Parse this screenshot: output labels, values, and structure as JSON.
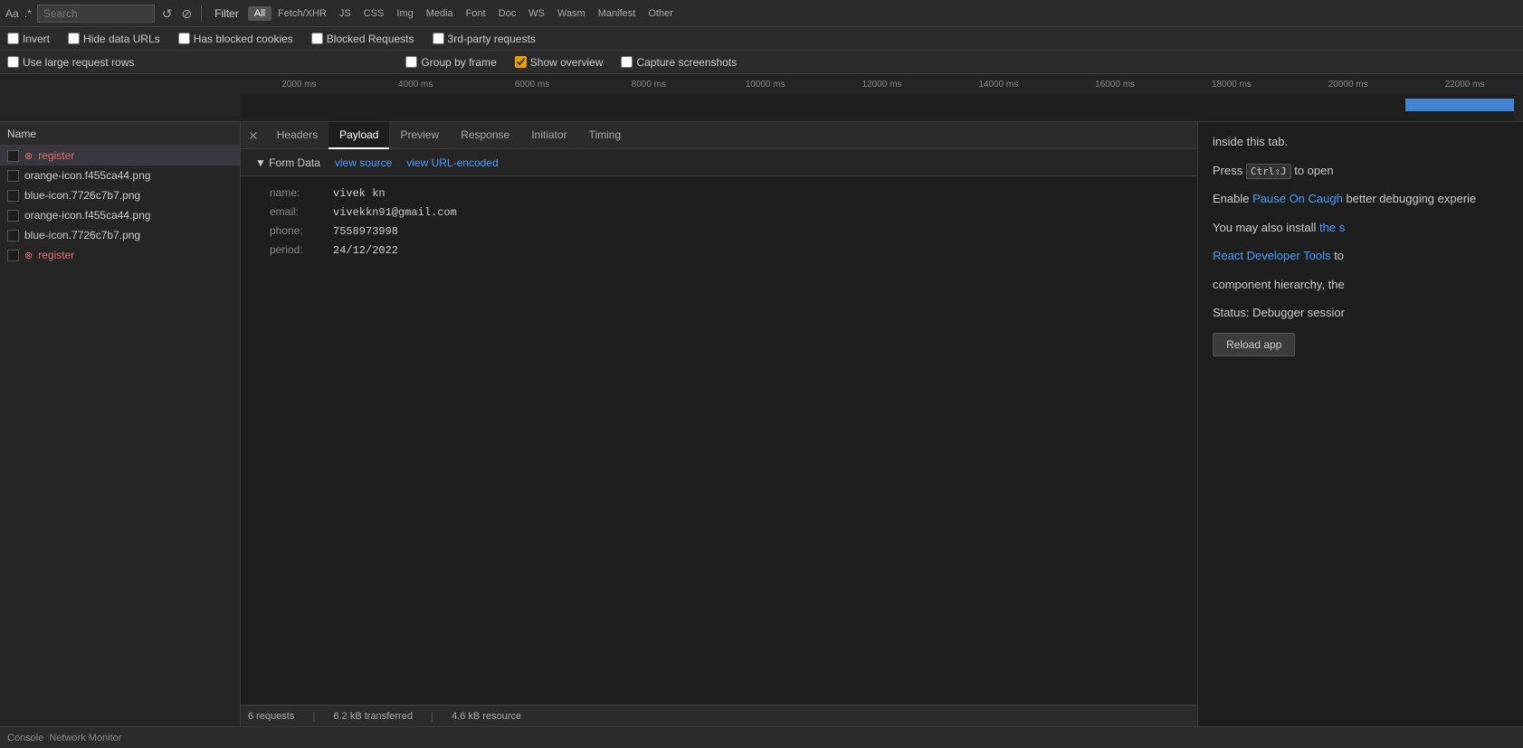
{
  "toolbar": {
    "aa_label": "Aa",
    "regex_label": ".*",
    "search_placeholder": "Search",
    "reload_icon": "↺",
    "block_icon": "⊘",
    "filter_label": "Filter",
    "filter_types": [
      "All",
      "Fetch/XHR",
      "JS",
      "CSS",
      "Img",
      "Media",
      "Font",
      "Doc",
      "WS",
      "Wasm",
      "Manifest",
      "Other"
    ],
    "active_filter": "All"
  },
  "checkboxes_row1": {
    "invert_label": "Invert",
    "hide_data_urls_label": "Hide data URLs",
    "has_blocked_cookies_label": "Has blocked cookies",
    "blocked_requests_label": "Blocked Requests",
    "third_party_label": "3rd-party requests"
  },
  "checkboxes_row2": {
    "use_large_rows_label": "Use large request rows",
    "group_by_frame_label": "Group by frame",
    "show_overview_label": "Show overview",
    "capture_screenshots_label": "Capture screenshots"
  },
  "timeline": {
    "labels": [
      "2000 ms",
      "4000 ms",
      "6000 ms",
      "8000 ms",
      "10000 ms",
      "12000 ms",
      "14000 ms",
      "16000 ms",
      "18000 ms",
      "20000 ms",
      "22000 ms"
    ]
  },
  "request_list": {
    "header": "Name",
    "items": [
      {
        "id": 1,
        "name": "register",
        "error": true,
        "selected": true
      },
      {
        "id": 2,
        "name": "orange-icon.f455ca44.png",
        "error": false,
        "selected": false
      },
      {
        "id": 3,
        "name": "blue-icon.7726c7b7.png",
        "error": false,
        "selected": false
      },
      {
        "id": 4,
        "name": "orange-icon.f455ca44.png",
        "error": false,
        "selected": false
      },
      {
        "id": 5,
        "name": "blue-icon.7726c7b7.png",
        "error": false,
        "selected": false
      },
      {
        "id": 6,
        "name": "register",
        "error": true,
        "selected": false
      }
    ]
  },
  "tabs": {
    "items": [
      "Headers",
      "Payload",
      "Preview",
      "Response",
      "Initiator",
      "Timing"
    ],
    "active": "Payload"
  },
  "payload": {
    "section_label": "▼ Form Data",
    "view_source_link": "view source",
    "view_url_encoded_link": "view URL-encoded",
    "fields": [
      {
        "key": "name:",
        "value": "vivek kn"
      },
      {
        "key": "email:",
        "value": "vivekkn91@gmail.com"
      },
      {
        "key": "phone:",
        "value": "7558973998"
      },
      {
        "key": "period:",
        "value": "24/12/2022"
      }
    ]
  },
  "status_bar": {
    "requests": "6 requests",
    "transferred": "6.2 kB transferred",
    "resources": "4.6 kB resource"
  },
  "right_sidebar": {
    "intro_text": "inside this tab.",
    "press_text": "Press ",
    "ctrl_j": "Ctrl⇧J",
    "open_text": " to open",
    "enable_text": "Enable ",
    "pause_link": "Pause On Caugh",
    "debugging_text": " better debugging experie",
    "install_text": "You may also install ",
    "react_link": "the s",
    "react_link2": "React Developer Tools",
    "react_text": " to",
    "component_text": " component hierarchy, the",
    "status_text": "Status: Debugger sessior",
    "reload_label": "Reload app"
  },
  "bottom_bar": {
    "console_label": "Console",
    "network_label": "Network Monitor"
  }
}
